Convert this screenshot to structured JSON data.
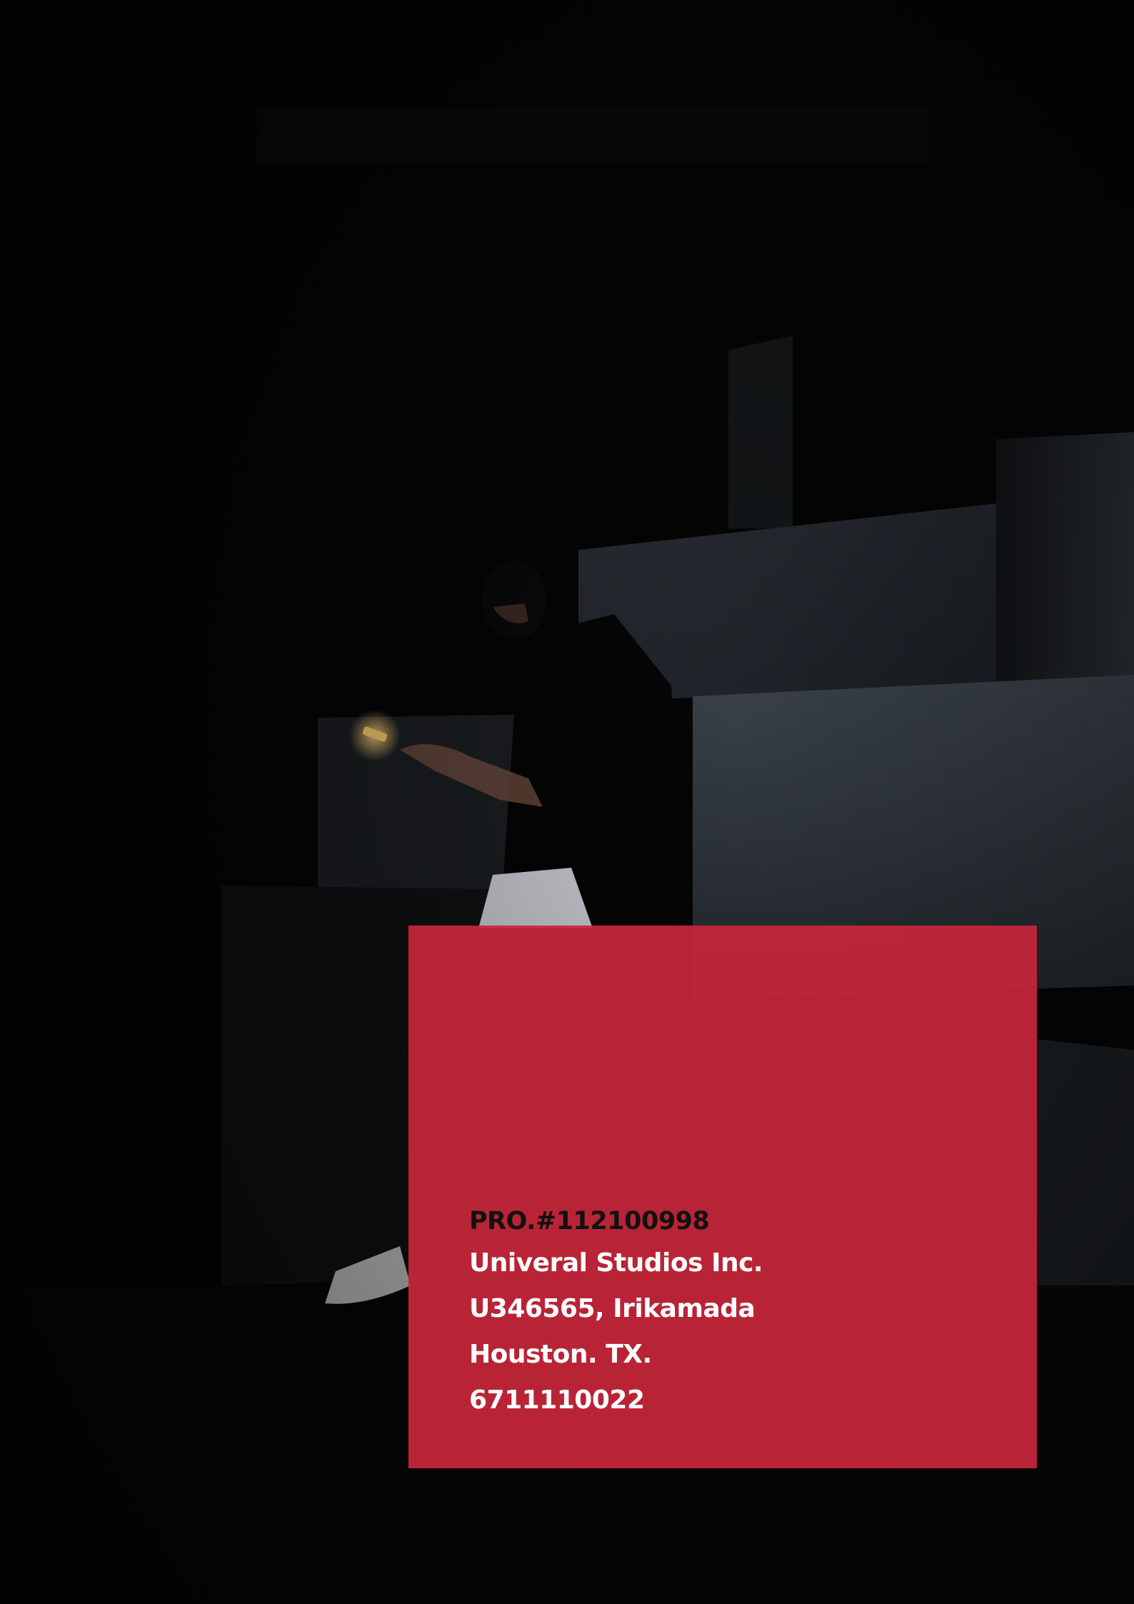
{
  "colors": {
    "background": "#050505",
    "panel": "#c6273a",
    "primary_text": "#ffffff",
    "project_text": "#111111"
  },
  "card": {
    "project_number": "PRO.#112100998",
    "company": "Univeral Studios Inc.",
    "address": "U346565, Irikamada",
    "city": "Houston. TX.",
    "phone": "6711110022"
  }
}
